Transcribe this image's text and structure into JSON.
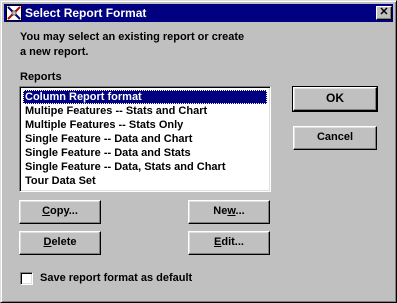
{
  "window": {
    "title": "Select Report Format",
    "close_glyph": "✕"
  },
  "intro": {
    "line1": "You may select an existing report or create",
    "line2": "a new report."
  },
  "reports": {
    "label": "Reports",
    "items": [
      "Column Report format",
      "Multipe Features -- Stats and Chart",
      "Multiple Features -- Stats Only",
      "Single Feature -- Data and Chart",
      "Single Feature -- Data and Stats",
      "Single Feature -- Data, Stats and Chart",
      "Tour Data Set"
    ],
    "selected_index": 0
  },
  "buttons": {
    "ok": "OK",
    "cancel": "Cancel",
    "copy_mnemonic": "C",
    "copy_rest": "opy...",
    "new_pre": "Ne",
    "new_mnemonic": "w",
    "new_post": "...",
    "delete_mnemonic": "D",
    "delete_rest": "elete",
    "edit_mnemonic": "E",
    "edit_rest": "dit..."
  },
  "checkbox": {
    "label": "Save report format as default",
    "checked": false
  },
  "colors": {
    "titlebar": "#000080",
    "face": "#c0c0c0",
    "selection": "#000080"
  },
  "icons": {
    "title": "app-chart-icon",
    "close": "close-icon"
  }
}
